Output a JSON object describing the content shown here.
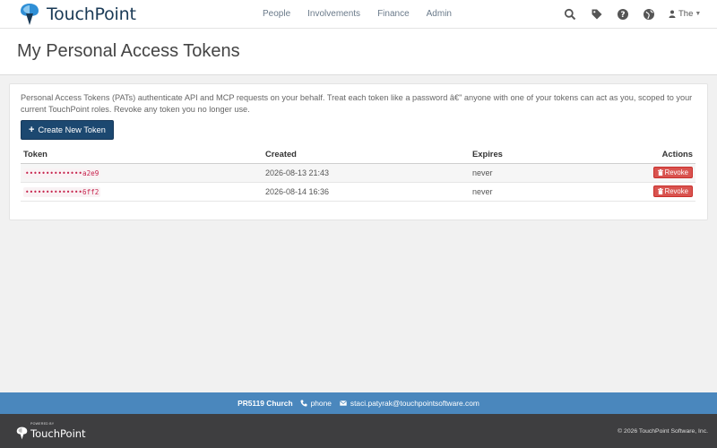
{
  "brand": {
    "name": "TouchPoint"
  },
  "nav": {
    "links": [
      "People",
      "Involvements",
      "Finance",
      "Admin"
    ],
    "icons": [
      "search-icon",
      "tag-icon",
      "help-icon",
      "globe-icon"
    ],
    "user": "The"
  },
  "page": {
    "title": "My Personal Access Tokens"
  },
  "panel": {
    "description": "Personal Access Tokens (PATs) authenticate API and MCP requests on your behalf. Treat each token like a password â€\" anyone with one of your tokens can act as you, scoped to your current TouchPoint roles. Revoke any token you no longer use.",
    "create_label": "Create New Token",
    "columns": [
      "Token",
      "Created",
      "Expires",
      "Actions"
    ],
    "rows": [
      {
        "token": "••••••••••••••a2e9",
        "created": "2026-08-13 21:43",
        "expires": "never",
        "action": "Revoke"
      },
      {
        "token": "••••••••••••••6ff2",
        "created": "2026-08-14 16:36",
        "expires": "never",
        "action": "Revoke"
      }
    ]
  },
  "footer": {
    "church": "PR5119 Church",
    "phone": "phone",
    "email": "staci.patyrak@touchpointsoftware.com",
    "powered_by": "POWERED BY",
    "brand": "TouchPoint",
    "copyright": "© 2026 TouchPoint Software, Inc."
  },
  "colors": {
    "primary": "#1c4870",
    "danger": "#d9534f",
    "footer_bar": "#4a87bd",
    "footer_bottom": "#3e3e40"
  }
}
